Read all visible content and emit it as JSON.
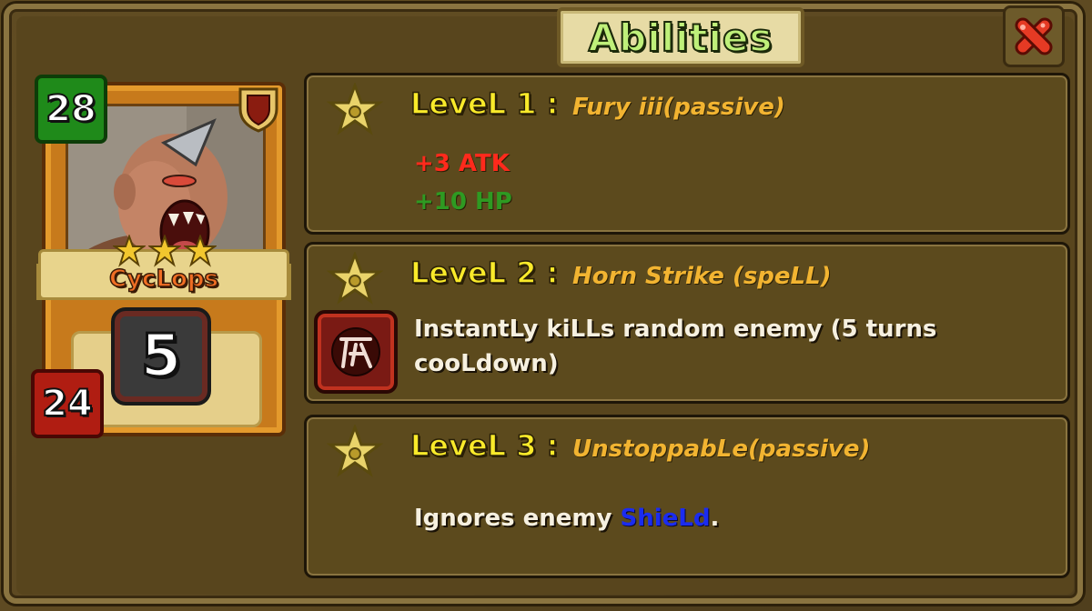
{
  "window": {
    "title": "Abilities",
    "close_icon": "close-icon"
  },
  "card": {
    "name": "CycLops",
    "attack": "28",
    "health": "24",
    "cost": "5",
    "stars": 3,
    "colors": {
      "attack": "#1f8a1a",
      "health": "#b01d12",
      "frame": "#c77a1c"
    }
  },
  "abilities": [
    {
      "level_label": "LeveL 1 :",
      "name": "Fury iii(passive)",
      "stats": [
        "+3 ATK",
        "+10 HP"
      ],
      "icon": "star-icon"
    },
    {
      "level_label": "LeveL 2 :",
      "name": "Horn Strike (speLL)",
      "description": "InstantLy kiLLs random enemy (5 turns cooLdown)",
      "icon": "star-icon",
      "spell_icon": "death-rune-icon"
    },
    {
      "level_label": "LeveL 3 :",
      "name": "UnstoppabLe(passive)",
      "description_prefix": "Ignores enemy ",
      "description_keyword": "ShieLd",
      "description_suffix": ".",
      "icon": "star-icon"
    }
  ],
  "colors": {
    "level_label": "#f9ea2a",
    "ability_name": "#f2b431",
    "atk": "#ff2a1c",
    "hp": "#2e9a22",
    "shield_keyword": "#1b2cf0"
  }
}
